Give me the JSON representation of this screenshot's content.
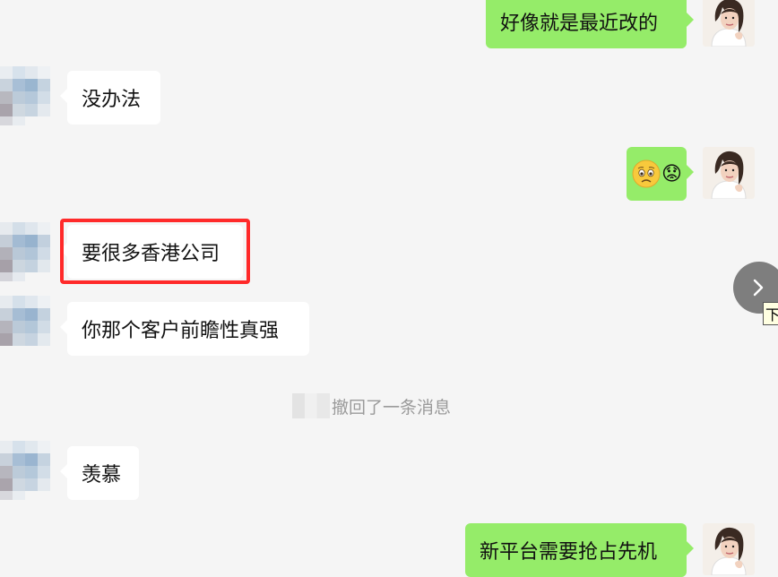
{
  "messages": [
    {
      "from": "me",
      "text": "好像就是最近改的"
    },
    {
      "from": "contact",
      "text": "没办法"
    },
    {
      "from": "me",
      "emoji": "😟"
    },
    {
      "from": "contact",
      "text": "要很多香港公司",
      "highlighted": true
    },
    {
      "from": "contact",
      "text": "你那个客户前瞻性真强"
    },
    {
      "from": "contact",
      "text": "羡慕"
    },
    {
      "from": "me",
      "text": "新平台需要抢占先机"
    }
  ],
  "system_note": {
    "text": "撤回了一条消息"
  },
  "scroll_down": {
    "icon": "chevron-right-icon",
    "tooltip": "下"
  },
  "colors": {
    "background": "#f5f5f5",
    "incoming_bubble": "#ffffff",
    "outgoing_bubble": "#95ec69",
    "highlight_box": "#ff2a2a"
  }
}
